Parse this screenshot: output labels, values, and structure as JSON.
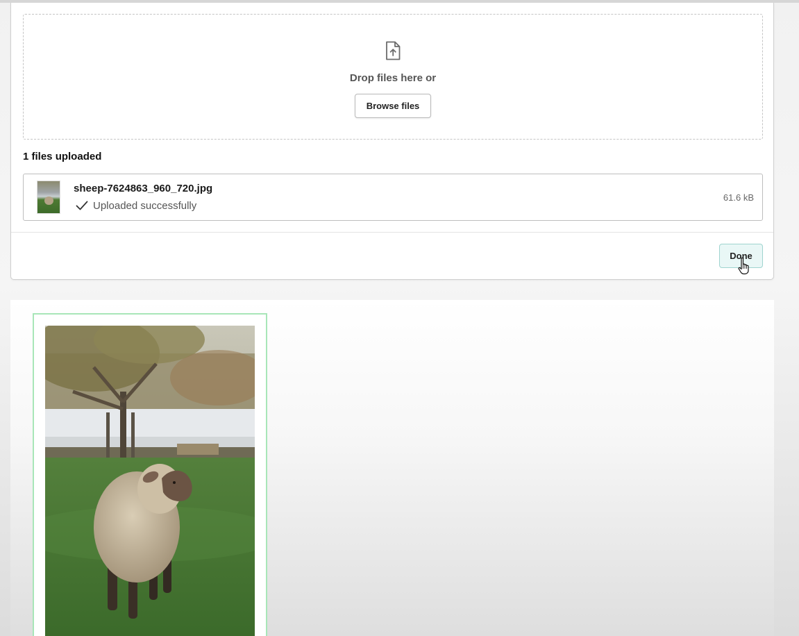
{
  "uploader": {
    "dropzone": {
      "icon": "file-upload-icon",
      "text": "Drop files here or",
      "browse_label": "Browse files"
    },
    "uploaded_count": "1 files uploaded",
    "file": {
      "name": "sheep-7624863_960_720.jpg",
      "status": "Uploaded successfully",
      "status_icon": "checkmark-icon",
      "size": "61.6 kB"
    },
    "done_label": "Done"
  },
  "gallery": {
    "image_subject": "sheep-photo",
    "card_border_color": "#a8e6b8"
  },
  "colors": {
    "done_bg": "#e9f7f6",
    "done_border": "#9fd4cf"
  }
}
